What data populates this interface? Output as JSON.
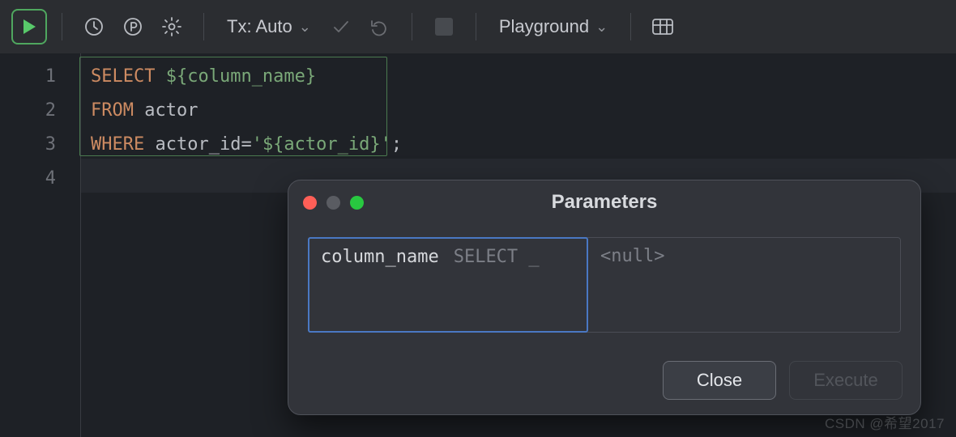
{
  "toolbar": {
    "tx_label": "Tx: Auto",
    "session_label": "Playground"
  },
  "editor": {
    "line_numbers": [
      "1",
      "2",
      "3",
      "4"
    ],
    "code": {
      "l1": {
        "kw": "SELECT",
        "rest": " ${column_name}"
      },
      "l2": {
        "kw": "FROM",
        "ident": " actor"
      },
      "l3": {
        "kw": "WHERE",
        "ident": " actor_id=",
        "str_open": "'",
        "tmpl": "${actor_id}",
        "str_close": "'",
        "punct": ";"
      }
    }
  },
  "dialog": {
    "title": "Parameters",
    "param_name": "column_name",
    "sql_fragment": "SELECT _",
    "value_placeholder": "<null>",
    "close_label": "Close",
    "execute_label": "Execute"
  },
  "watermark": "CSDN @希望2017"
}
